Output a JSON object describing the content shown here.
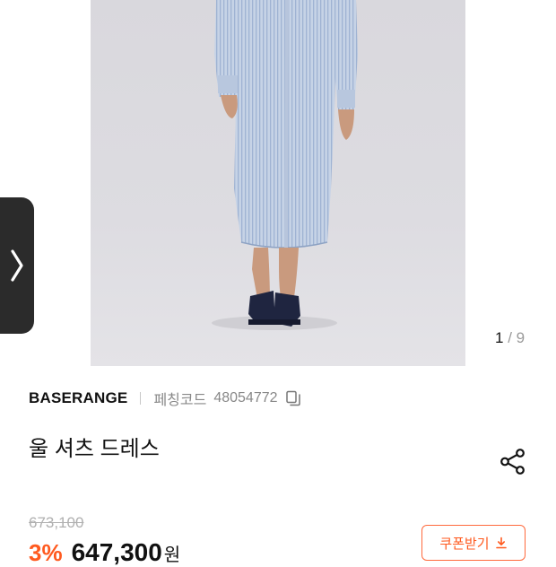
{
  "gallery": {
    "current": "1",
    "separator": "/",
    "total": "9"
  },
  "product": {
    "brand": "BASERANGE",
    "code_label": "페칭코드",
    "code_value": "48054772",
    "name": "울 셔츠 드레스",
    "original_price": "673,100",
    "discount": "3%",
    "sale_price": "647,300",
    "currency": "원"
  },
  "coupon": {
    "label": "쿠폰받기"
  },
  "icons": {
    "copy": "copy-icon",
    "share": "share-icon",
    "download": "download-icon",
    "chevron": "chevron-right-icon"
  },
  "colors": {
    "accent": "#ff5a1f",
    "handle": "#2b2b2b",
    "muted": "#888888"
  }
}
